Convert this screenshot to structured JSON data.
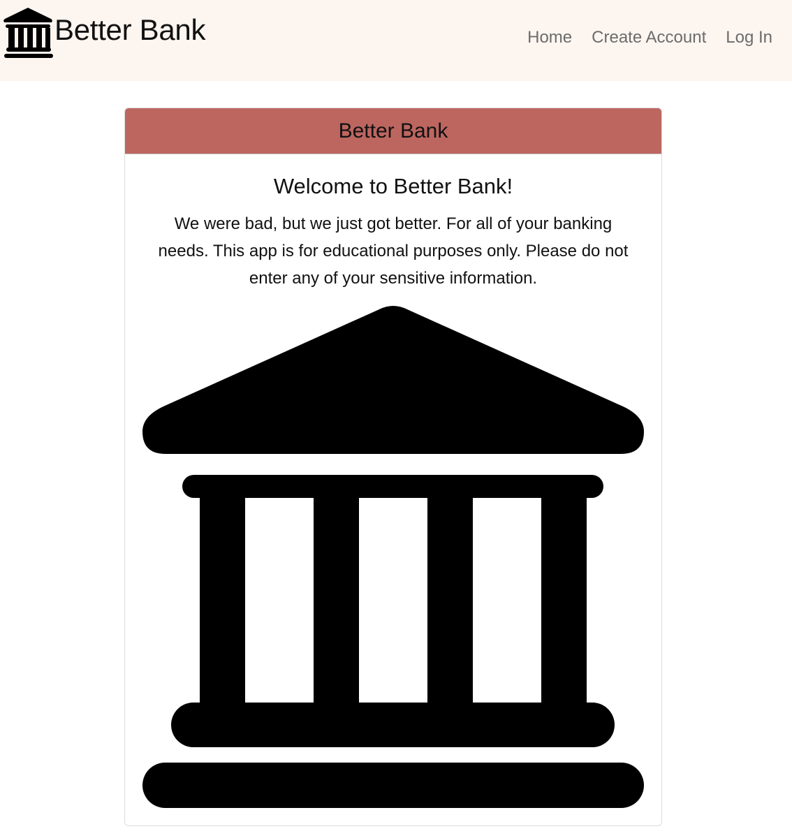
{
  "navbar": {
    "brand": {
      "icon": "bank-icon",
      "label": "Better Bank"
    },
    "links": [
      {
        "label": "Home"
      },
      {
        "label": "Create Account"
      },
      {
        "label": "Log In"
      }
    ]
  },
  "card": {
    "header": "Better Bank",
    "title": "Welcome to Better Bank!",
    "text": "We were bad, but we just got better. For all of your banking needs. This app is for educational purposes only. Please do not enter any of your sensitive information.",
    "image_icon": "bank-icon"
  },
  "colors": {
    "navbar_bg": "#fdf5f0",
    "card_header_bg": "#bd6660",
    "nav_link": "#6c6c6c"
  }
}
